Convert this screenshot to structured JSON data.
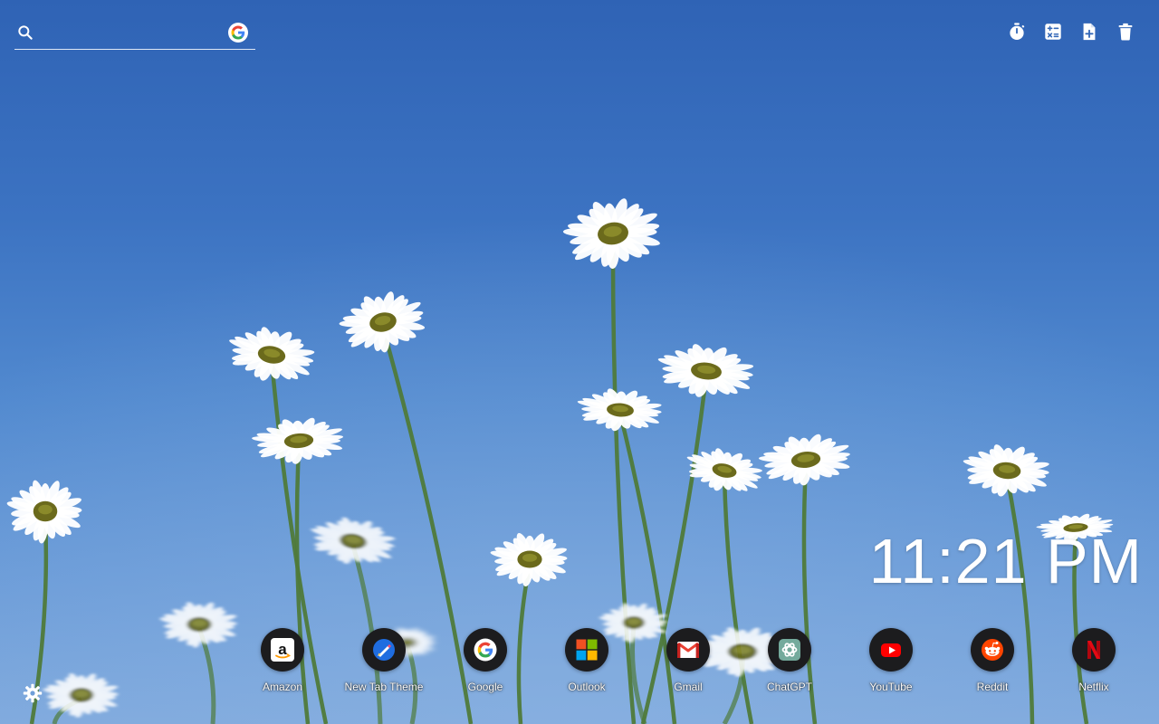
{
  "search": {
    "placeholder": "",
    "value": "",
    "engine_icon": "google-g-icon"
  },
  "toolbar": [
    {
      "name": "timer-button",
      "icon": "stopwatch-icon"
    },
    {
      "name": "calculator-button",
      "icon": "calculator-icon"
    },
    {
      "name": "new-note-button",
      "icon": "file-plus-icon"
    },
    {
      "name": "trash-button",
      "icon": "trash-icon"
    }
  ],
  "clock": {
    "time": "11:21 PM"
  },
  "shortcuts": [
    {
      "label": "Amazon",
      "icon": "amazon-icon"
    },
    {
      "label": "New Tab Theme",
      "icon": "new-tab-theme-icon"
    },
    {
      "label": "Google",
      "icon": "google-icon"
    },
    {
      "label": "Outlook",
      "icon": "outlook-icon"
    },
    {
      "label": "Gmail",
      "icon": "gmail-icon"
    },
    {
      "label": "ChatGPT",
      "icon": "chatgpt-icon"
    },
    {
      "label": "YouTube",
      "icon": "youtube-icon"
    },
    {
      "label": "Reddit",
      "icon": "reddit-icon"
    },
    {
      "label": "Netflix",
      "icon": "netflix-icon"
    }
  ],
  "settings": {
    "icon": "gear-icon"
  },
  "colors": {
    "sky_top": "#2f63b5",
    "sky_bottom": "#7fa9dd",
    "petal": "#ffffff",
    "flower_center": "#6b6a1c",
    "stem": "#4f7a3a",
    "dock_circle": "#1c1c1e"
  }
}
